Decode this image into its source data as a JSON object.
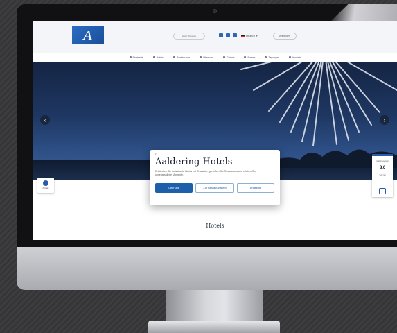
{
  "site": {
    "logo_glyph": "A",
    "search_placeholder": "Hotel Webseite",
    "language": "Deutsch",
    "account_label": "Anmelden"
  },
  "nav": {
    "items": [
      "Startseite",
      "Hotels",
      "Restaurants",
      "Über uns",
      "Galerie",
      "Events",
      "Tagungen",
      "Kontakt"
    ]
  },
  "modal": {
    "close_glyph": "×",
    "title": "Aaldering Hotels",
    "text": "Entdecken Sie individuelle Hotels mit Charakter, genießen Sie Restaurants und erleben Sie unvergessliche Momente.",
    "primary_button": "Über uns",
    "restaurant_button": "Zur Restaurantwahl",
    "offers_button": "Angebote"
  },
  "hero": {
    "prev_glyph": "‹",
    "next_glyph": "›"
  },
  "chat": {
    "label": "Kontakt"
  },
  "widget": {
    "caption_top": "Gäste­bewertung",
    "rating": "8.6",
    "caption_bottom": "Sehr gut"
  },
  "main": {
    "section_title": "Hotels"
  },
  "colors": {
    "brand_blue": "#1d5fa8",
    "hero_sky": "#1e3762",
    "bezel": "#111113"
  }
}
